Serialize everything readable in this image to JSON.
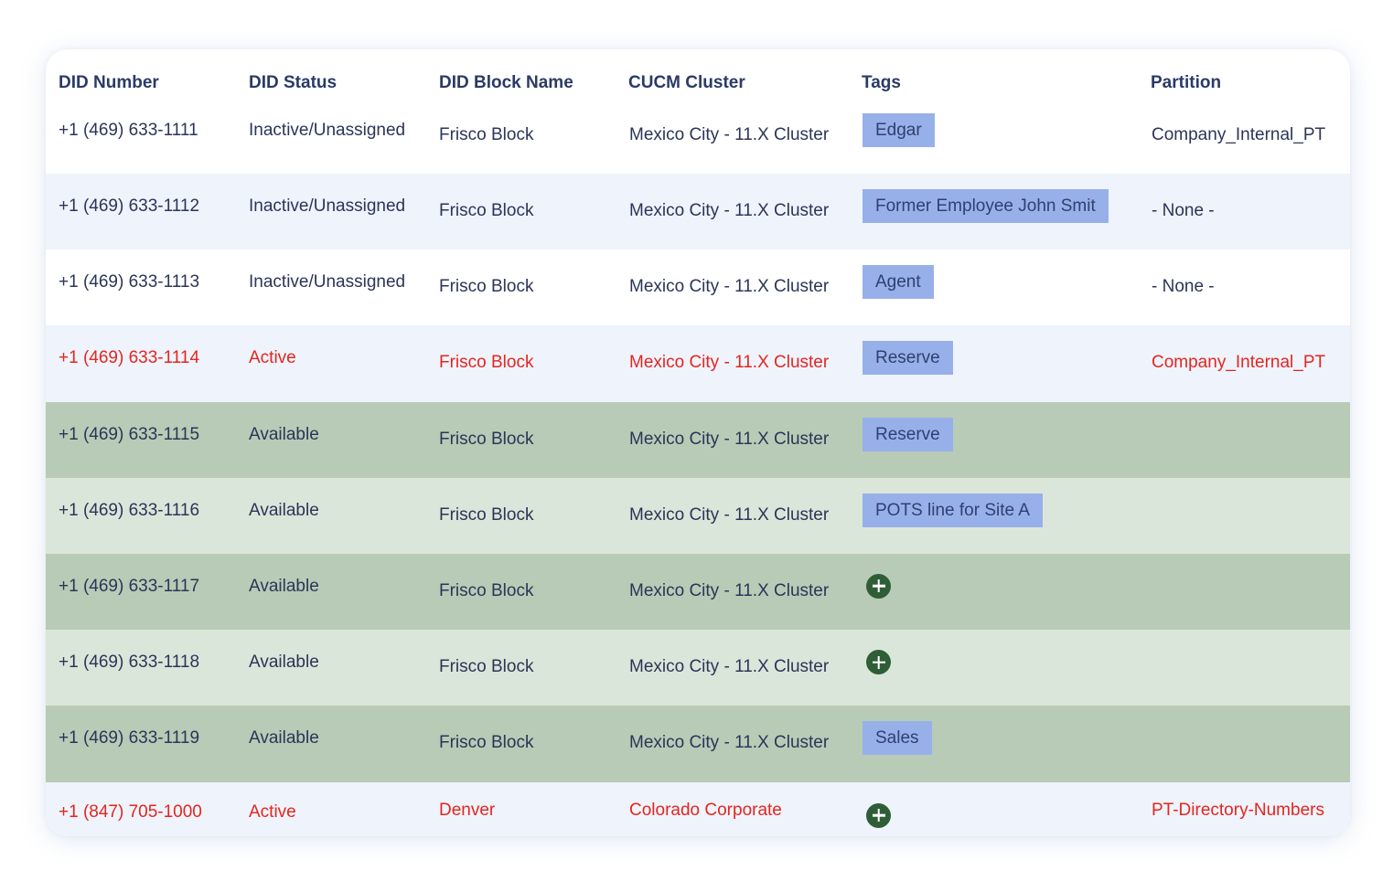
{
  "table": {
    "columns": [
      "DID Number",
      "DID Status",
      "DID Block Name",
      "CUCM Cluster",
      "Tags",
      "Partition"
    ],
    "rows": [
      {
        "number": "+1 (469) 633-1111",
        "status": "Inactive/Unassigned",
        "block": "Frisco Block",
        "cluster": "Mexico City - 11.X Cluster",
        "tag": "Edgar",
        "add_icon": false,
        "partition": "Company_Internal_PT",
        "style": "white",
        "highlight": false
      },
      {
        "number": "+1 (469) 633-1112",
        "status": "Inactive/Unassigned",
        "block": "Frisco Block",
        "cluster": "Mexico City - 11.X Cluster",
        "tag": "Former Employee John Smit",
        "add_icon": false,
        "partition": "- None -",
        "style": "blue",
        "highlight": false
      },
      {
        "number": "+1 (469) 633-1113",
        "status": "Inactive/Unassigned",
        "block": "Frisco Block",
        "cluster": "Mexico City - 11.X Cluster",
        "tag": "Agent",
        "add_icon": false,
        "partition": "- None -",
        "style": "white",
        "highlight": false
      },
      {
        "number": "+1 (469) 633-1114",
        "status": "Active",
        "block": "Frisco Block",
        "cluster": "Mexico City - 11.X Cluster",
        "tag": "Reserve",
        "add_icon": false,
        "partition": "Company_Internal_PT",
        "style": "blue",
        "highlight": true
      },
      {
        "number": "+1 (469) 633-1115",
        "status": "Available",
        "block": "Frisco Block",
        "cluster": "Mexico City - 11.X Cluster",
        "tag": "Reserve",
        "add_icon": false,
        "partition": "",
        "style": "green-dark",
        "highlight": false
      },
      {
        "number": "+1 (469) 633-1116",
        "status": "Available",
        "block": "Frisco Block",
        "cluster": "Mexico City - 11.X Cluster",
        "tag": "POTS line for Site A",
        "add_icon": false,
        "partition": "",
        "style": "green-light",
        "highlight": false
      },
      {
        "number": "+1 (469) 633-1117",
        "status": "Available",
        "block": "Frisco Block",
        "cluster": "Mexico City - 11.X Cluster",
        "tag": "",
        "add_icon": true,
        "partition": "",
        "style": "green-dark",
        "highlight": false
      },
      {
        "number": "+1 (469) 633-1118",
        "status": "Available",
        "block": "Frisco Block",
        "cluster": "Mexico City - 11.X Cluster",
        "tag": "",
        "add_icon": true,
        "partition": "",
        "style": "green-light",
        "highlight": false
      },
      {
        "number": "+1 (469) 633-1119",
        "status": "Available",
        "block": "Frisco Block",
        "cluster": "Mexico City - 11.X Cluster",
        "tag": "Sales",
        "add_icon": false,
        "partition": "",
        "style": "green-dark",
        "highlight": false
      },
      {
        "number": "+1 (847) 705-1000",
        "status": "Active",
        "block": "Denver",
        "cluster": "Colorado Corporate",
        "tag": "",
        "add_icon": true,
        "partition": "PT-Directory-Numbers",
        "style": "blue",
        "highlight": true
      }
    ]
  },
  "colors": {
    "header_text": "#2b3a66",
    "body_text": "#2b3558",
    "active_red": "#e3261f",
    "tag_bg": "#98b0ea",
    "tag_text": "#2f4070",
    "row_blue": "#eff3fc",
    "row_green_dark": "#b8cbb6",
    "row_green_light": "#dbe6da",
    "add_icon": "#2f5e36"
  },
  "icons": {
    "add": "plus-circle-icon"
  }
}
